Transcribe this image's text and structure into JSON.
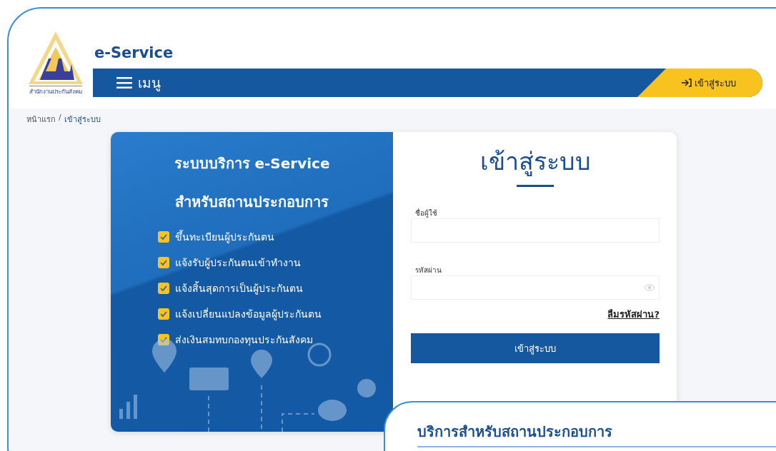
{
  "logo": {
    "caption": "สำนักงานประกันสังคม"
  },
  "site_title": "e-Service",
  "nav": {
    "menu_label": "เมนู",
    "login_button": "เข้าสู่ระบบ"
  },
  "breadcrumb": {
    "items": [
      "หน้าแรก",
      "เข้าสู่ระบบ"
    ],
    "separator": "/"
  },
  "promo": {
    "title_lines": [
      "ระบบบริการ e-Service",
      "สำหรับสถานประกอบการ"
    ],
    "features": [
      {
        "label": "ขึ้นทะเบียนผู้ประกันตน",
        "checked": true
      },
      {
        "label": "แจ้งรับผู้ประกันตนเข้าทำงาน",
        "checked": true
      },
      {
        "label": "แจ้งสิ้นสุดการเป็นผู้ประกันตน",
        "checked": true
      },
      {
        "label": "แจ้งเปลี่ยนแปลงข้อมูลผู้ประกันตน",
        "checked": true
      },
      {
        "label": "ส่งเงินสมทบกองทุนประกันสังคม",
        "checked": true
      }
    ]
  },
  "login_form": {
    "title": "เข้าสู่ระบบ",
    "fields": [
      {
        "label": "ชื่อผู้ใช้",
        "kind": "text"
      },
      {
        "label": "รหัสผ่าน",
        "kind": "password"
      }
    ],
    "forgot_link": "ลืมรหัสผ่าน?",
    "submit": "เข้าสู่ระบบ"
  },
  "services_card": {
    "title": "บริการสำหรับสถานประกอบการ"
  }
}
